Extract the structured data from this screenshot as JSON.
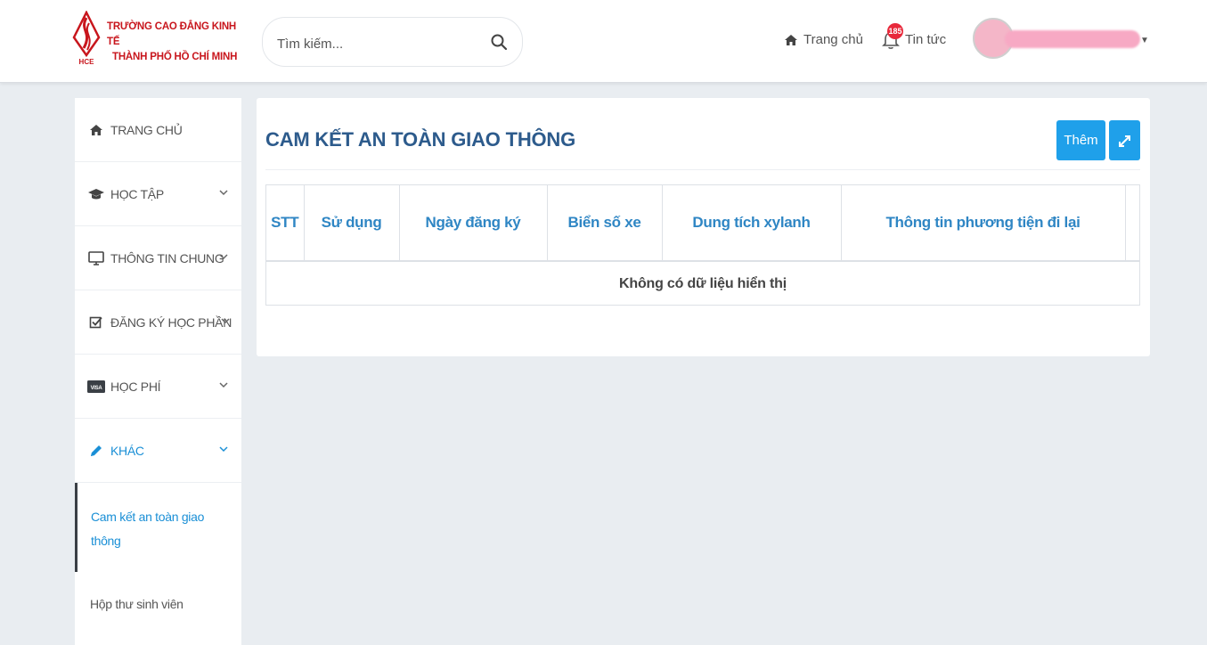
{
  "header": {
    "logo": {
      "line1": "TRƯỜNG CAO ĐẲNG KINH TẾ",
      "line2": "THÀNH PHỐ HỒ CHÍ MINH",
      "mark_text": "HCE",
      "brand_color": "#c8161d"
    },
    "search": {
      "placeholder": "Tìm kiếm..."
    },
    "nav": {
      "home_label": "Trang chủ",
      "news_label": "Tin tức",
      "news_badge": "185"
    }
  },
  "sidebar": {
    "items": [
      {
        "label": "TRANG CHỦ",
        "icon": "home-icon"
      },
      {
        "label": "HỌC TẬP",
        "icon": "graduation-cap-icon"
      },
      {
        "label": "THÔNG TIN CHUNG",
        "icon": "monitor-icon"
      },
      {
        "label": "ĐĂNG KÝ HỌC PHẦN",
        "icon": "checkbox-icon"
      },
      {
        "label": "HỌC PHÍ",
        "icon": "visa-card-icon"
      },
      {
        "label": "KHÁC",
        "icon": "pencil-icon"
      }
    ],
    "subitems": [
      {
        "label": "Cam kết an toàn giao thông"
      },
      {
        "label": "Hộp thư sinh viên"
      }
    ]
  },
  "main": {
    "title": "CAM KẾT AN TOÀN GIAO THÔNG",
    "add_label": "Thêm",
    "table": {
      "headers": [
        "STT",
        "Sử dụng",
        "Ngày đăng ký",
        "Biển số xe",
        "Dung tích xylanh",
        "Thông tin phương tiện đi lại"
      ],
      "empty_message": "Không có dữ liệu hiển thị"
    }
  },
  "colors": {
    "accent": "#1fa0ea",
    "title": "#2d5b8c",
    "header_text": "#2f86c4",
    "background": "#e9edf1"
  }
}
